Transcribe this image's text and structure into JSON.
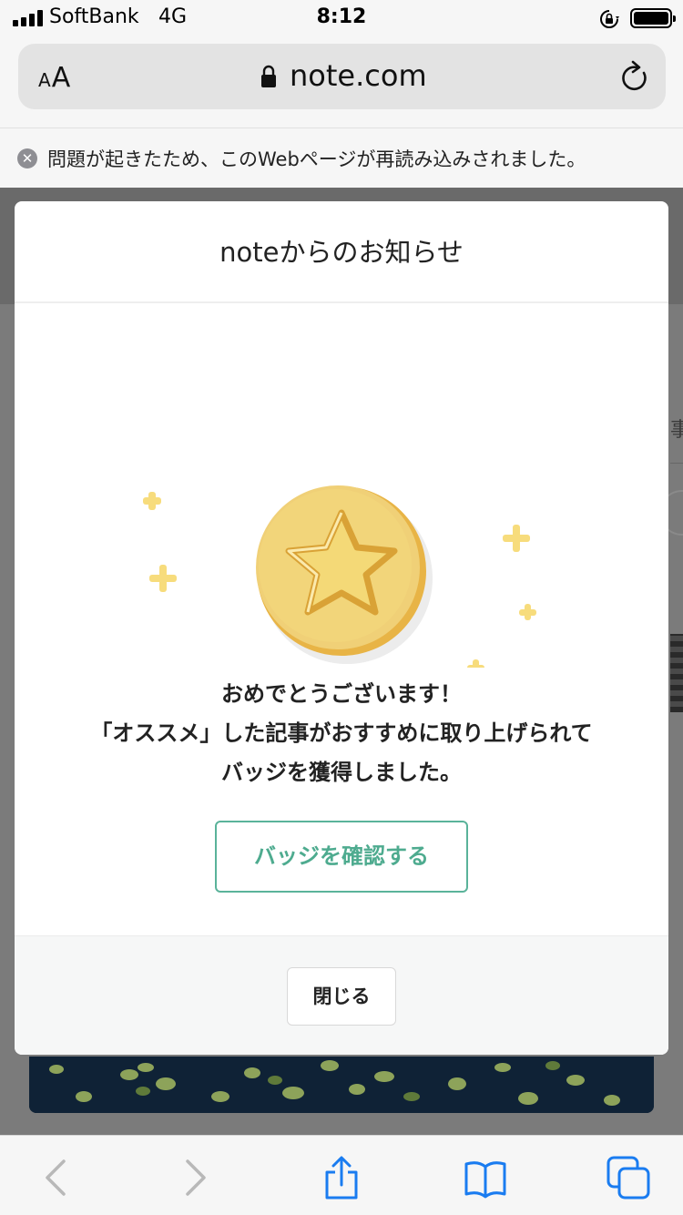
{
  "status_bar": {
    "carrier": "SoftBank",
    "network": "4G",
    "time": "8:12"
  },
  "url_bar": {
    "text_size_label": "AA",
    "url": "note.com"
  },
  "notice": {
    "message": "問題が起きたため、このWebページが再読み込みされました。"
  },
  "background_page": {
    "edge_char": "事"
  },
  "modal": {
    "title": "noteからのお知らせ",
    "message_lines": [
      "おめでとうございます！",
      "「オススメ」した記事がおすすめに取り上げられて",
      "バッジを獲得しました。"
    ],
    "confirm_button": "バッジを確認する",
    "close_button": "閉じる",
    "colors": {
      "accent_green": "#5ab39a",
      "coin_gold": "#f2d57a",
      "coin_rim": "#e6b44a",
      "sparkle": "#f7dc7c"
    }
  },
  "toolbar": {
    "icons": [
      "back-icon",
      "forward-icon",
      "share-icon",
      "bookmarks-icon",
      "tabs-icon"
    ]
  }
}
